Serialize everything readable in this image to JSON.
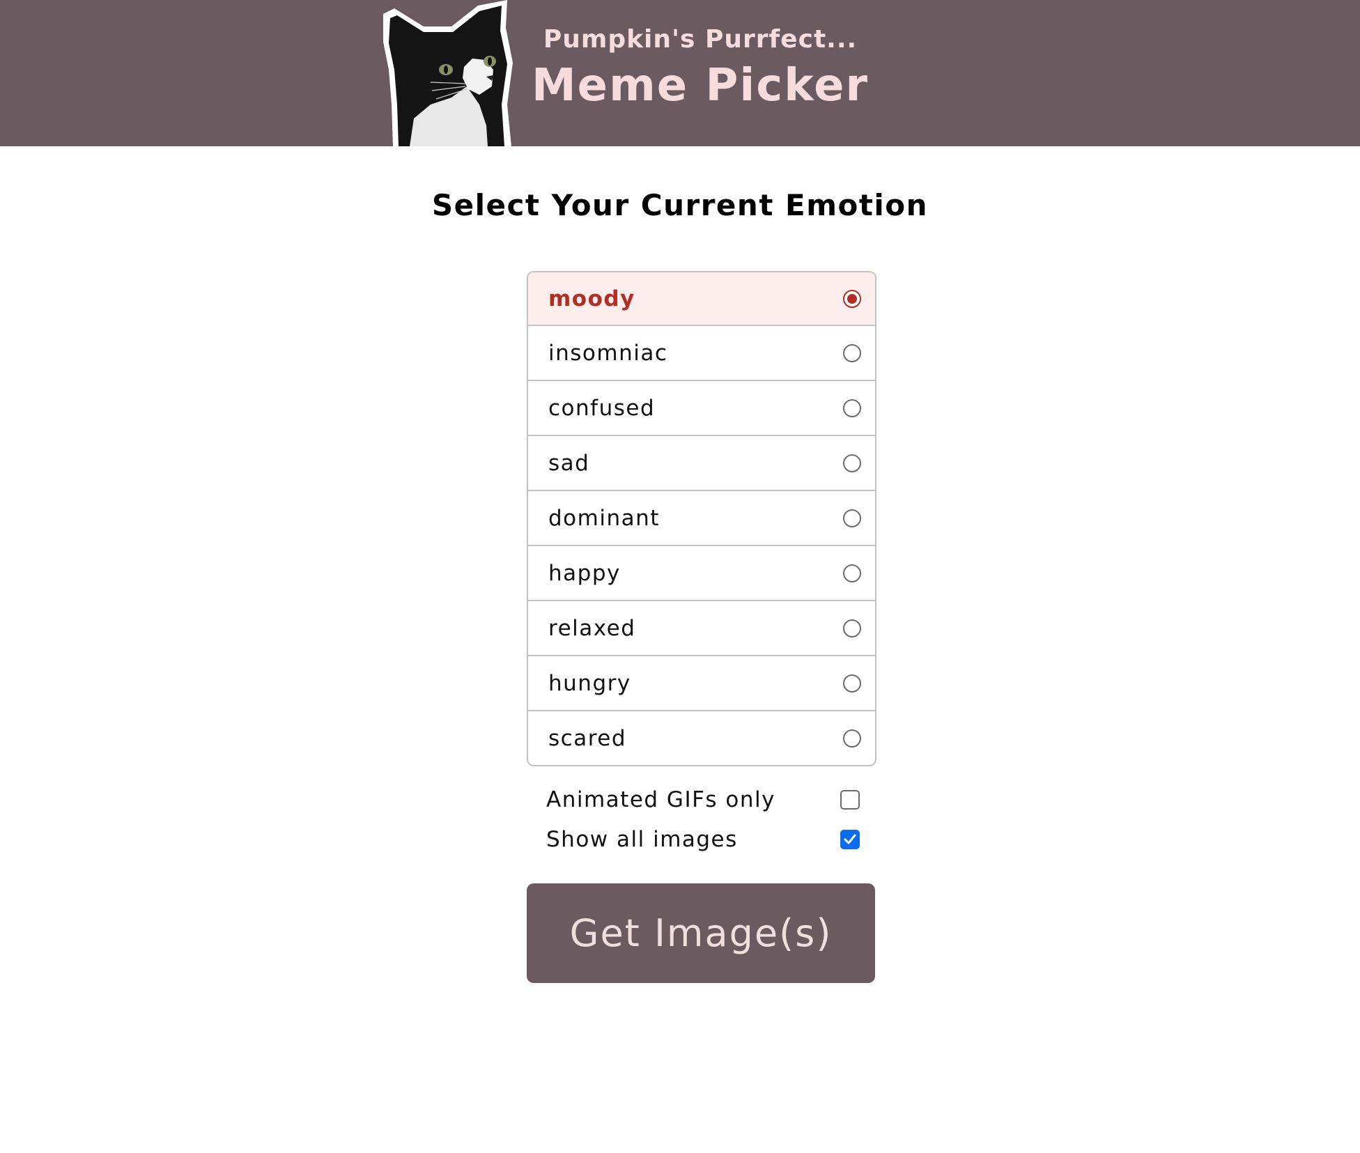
{
  "header": {
    "subtitle": "Pumpkin's Purrfect...",
    "title": "Meme Picker",
    "logo_icon": "cat-photo"
  },
  "main": {
    "heading": "Select Your Current Emotion",
    "selected_emotion": "moody",
    "emotions": [
      {
        "label": "moody",
        "selected": true
      },
      {
        "label": "insomniac",
        "selected": false
      },
      {
        "label": "confused",
        "selected": false
      },
      {
        "label": "sad",
        "selected": false
      },
      {
        "label": "dominant",
        "selected": false
      },
      {
        "label": "happy",
        "selected": false
      },
      {
        "label": "relaxed",
        "selected": false
      },
      {
        "label": "hungry",
        "selected": false
      },
      {
        "label": "scared",
        "selected": false
      }
    ],
    "options": {
      "animated_gifs_label": "Animated GIFs only",
      "animated_gifs_checked": false,
      "show_all_label": "Show all images",
      "show_all_checked": true
    },
    "submit_label": "Get Image(s)"
  },
  "colors": {
    "header_bg": "#6b5a60",
    "title_text": "#f6dcdc",
    "selected_text": "#b32d25",
    "selected_bg": "#fdeeee",
    "checkbox_blue": "#0b6cf0"
  }
}
